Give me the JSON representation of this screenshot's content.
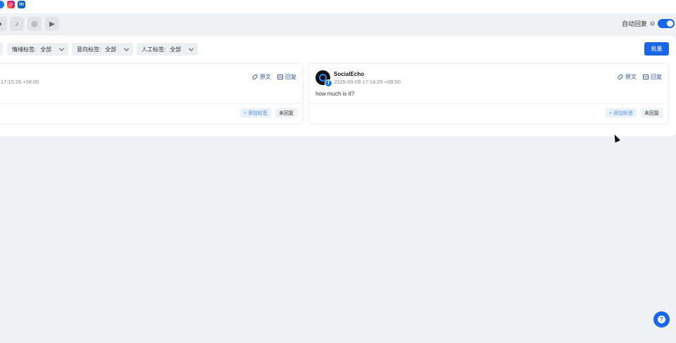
{
  "top_social_icons": [
    {
      "icon": "facebook-icon",
      "glyph": ""
    },
    {
      "icon": "instagram-icon",
      "glyph": "◎"
    },
    {
      "icon": "linkedin-icon",
      "glyph": "in"
    }
  ],
  "platform_filters": [
    {
      "icon": "partial-platform-icon",
      "glyph": "●"
    },
    {
      "icon": "tiktok-icon",
      "glyph": "♪"
    },
    {
      "icon": "instagram-icon",
      "glyph": "◎"
    },
    {
      "icon": "youtube-icon",
      "glyph": "▶"
    }
  ],
  "auto_reply": {
    "label": "自动回复",
    "help": "?",
    "enabled": true
  },
  "filters": [
    {
      "label": "情绪标签:",
      "value": "全部"
    },
    {
      "label": "意向标签:",
      "value": "全部"
    },
    {
      "label": "人工标签:",
      "value": "全部"
    }
  ],
  "batch_button": "批量",
  "cards": [
    {
      "author": "",
      "time": "17:15:26 +08:00",
      "message": "",
      "source_label": "原文",
      "reply_label": "回复",
      "add_tag_label": "+ 添加标签",
      "status": "未回复"
    },
    {
      "author": "SocialEcho",
      "time": "2025-09-09 17:14:29 +08:00",
      "message": "how much is it?",
      "platform_badge": "f",
      "source_label": "原文",
      "reply_label": "回复",
      "add_tag_label": "+ 添加标签",
      "status": "未回复"
    }
  ],
  "help_button": "?",
  "colors": {
    "accent": "#1a66e6",
    "facebook": "#1877f2",
    "link": "#3a5c9c"
  }
}
